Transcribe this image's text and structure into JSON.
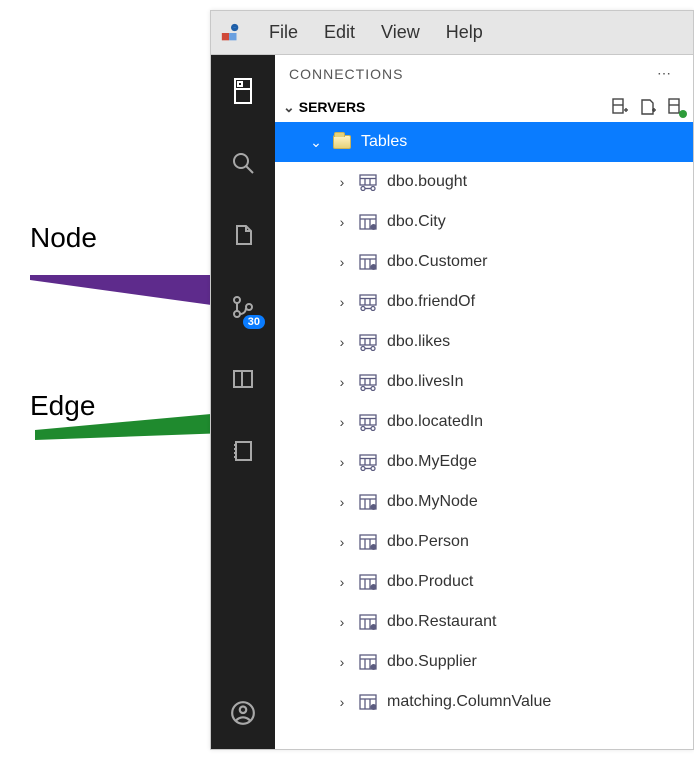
{
  "annotations": {
    "node": "Node",
    "edge": "Edge"
  },
  "menubar": {
    "file": "File",
    "edit": "Edit",
    "view": "View",
    "help": "Help"
  },
  "activity_bar": {
    "badge": "30"
  },
  "panel": {
    "title": "CONNECTIONS",
    "section": "SERVERS"
  },
  "tree": {
    "tables_label": "Tables",
    "items": [
      {
        "name": "dbo.bought",
        "iconType": "edge"
      },
      {
        "name": "dbo.City",
        "iconType": "node"
      },
      {
        "name": "dbo.Customer",
        "iconType": "node"
      },
      {
        "name": "dbo.friendOf",
        "iconType": "edge"
      },
      {
        "name": "dbo.likes",
        "iconType": "edge"
      },
      {
        "name": "dbo.livesIn",
        "iconType": "edge"
      },
      {
        "name": "dbo.locatedIn",
        "iconType": "edge"
      },
      {
        "name": "dbo.MyEdge",
        "iconType": "edge"
      },
      {
        "name": "dbo.MyNode",
        "iconType": "node"
      },
      {
        "name": "dbo.Person",
        "iconType": "node"
      },
      {
        "name": "dbo.Product",
        "iconType": "node"
      },
      {
        "name": "dbo.Restaurant",
        "iconType": "node"
      },
      {
        "name": "dbo.Supplier",
        "iconType": "node"
      },
      {
        "name": "matching.ColumnValue",
        "iconType": "node"
      }
    ]
  }
}
